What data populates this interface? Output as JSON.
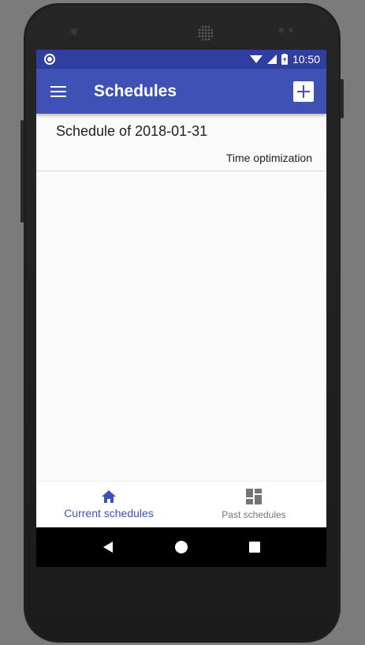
{
  "status_bar": {
    "time": "10:50"
  },
  "app_bar": {
    "title": "Schedules"
  },
  "schedules": [
    {
      "title": "Schedule of 2018-01-31",
      "subtitle": "Time optimization"
    }
  ],
  "bottom_nav": {
    "current": {
      "label": "Current schedules",
      "icon": "home-icon"
    },
    "past": {
      "label": "Past schedules",
      "icon": "dashboard-icon"
    }
  },
  "colors": {
    "primary": "#3f51b5",
    "primary_dark": "#303f9f",
    "inactive": "#757575"
  }
}
